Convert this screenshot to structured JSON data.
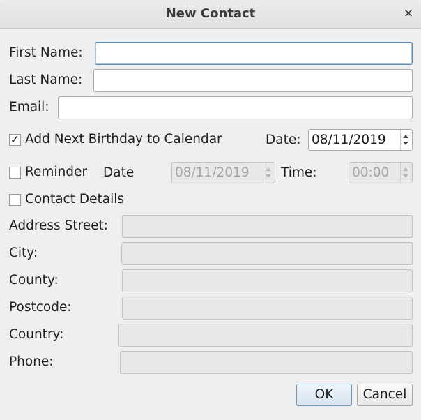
{
  "window": {
    "title": "New Contact",
    "close_glyph": "×"
  },
  "form": {
    "first_name_label": "First Name:",
    "first_name_value": "",
    "last_name_label": "Last Name:",
    "last_name_value": "",
    "email_label": "Email:",
    "email_value": "",
    "birthday_checkbox_label": "Add Next Birthday to Calendar",
    "birthday_checked": true,
    "check_glyph": "✓",
    "birthday_date_label": "Date:",
    "birthday_date_value": "08/11/2019",
    "reminder_checkbox_label": "Reminder",
    "reminder_checked": false,
    "reminder_date_label": "Date",
    "reminder_date_value": "08/11/2019",
    "reminder_time_label": "Time:",
    "reminder_time_value": "00:00",
    "contact_details_checkbox_label": "Contact Details",
    "contact_details_checked": false,
    "address_street_label": "Address Street:",
    "city_label": "City:",
    "county_label": "County:",
    "postcode_label": "Postcode:",
    "country_label": "Country:",
    "phone_label": "Phone:"
  },
  "buttons": {
    "ok_label": "OK",
    "cancel_label": "Cancel"
  }
}
